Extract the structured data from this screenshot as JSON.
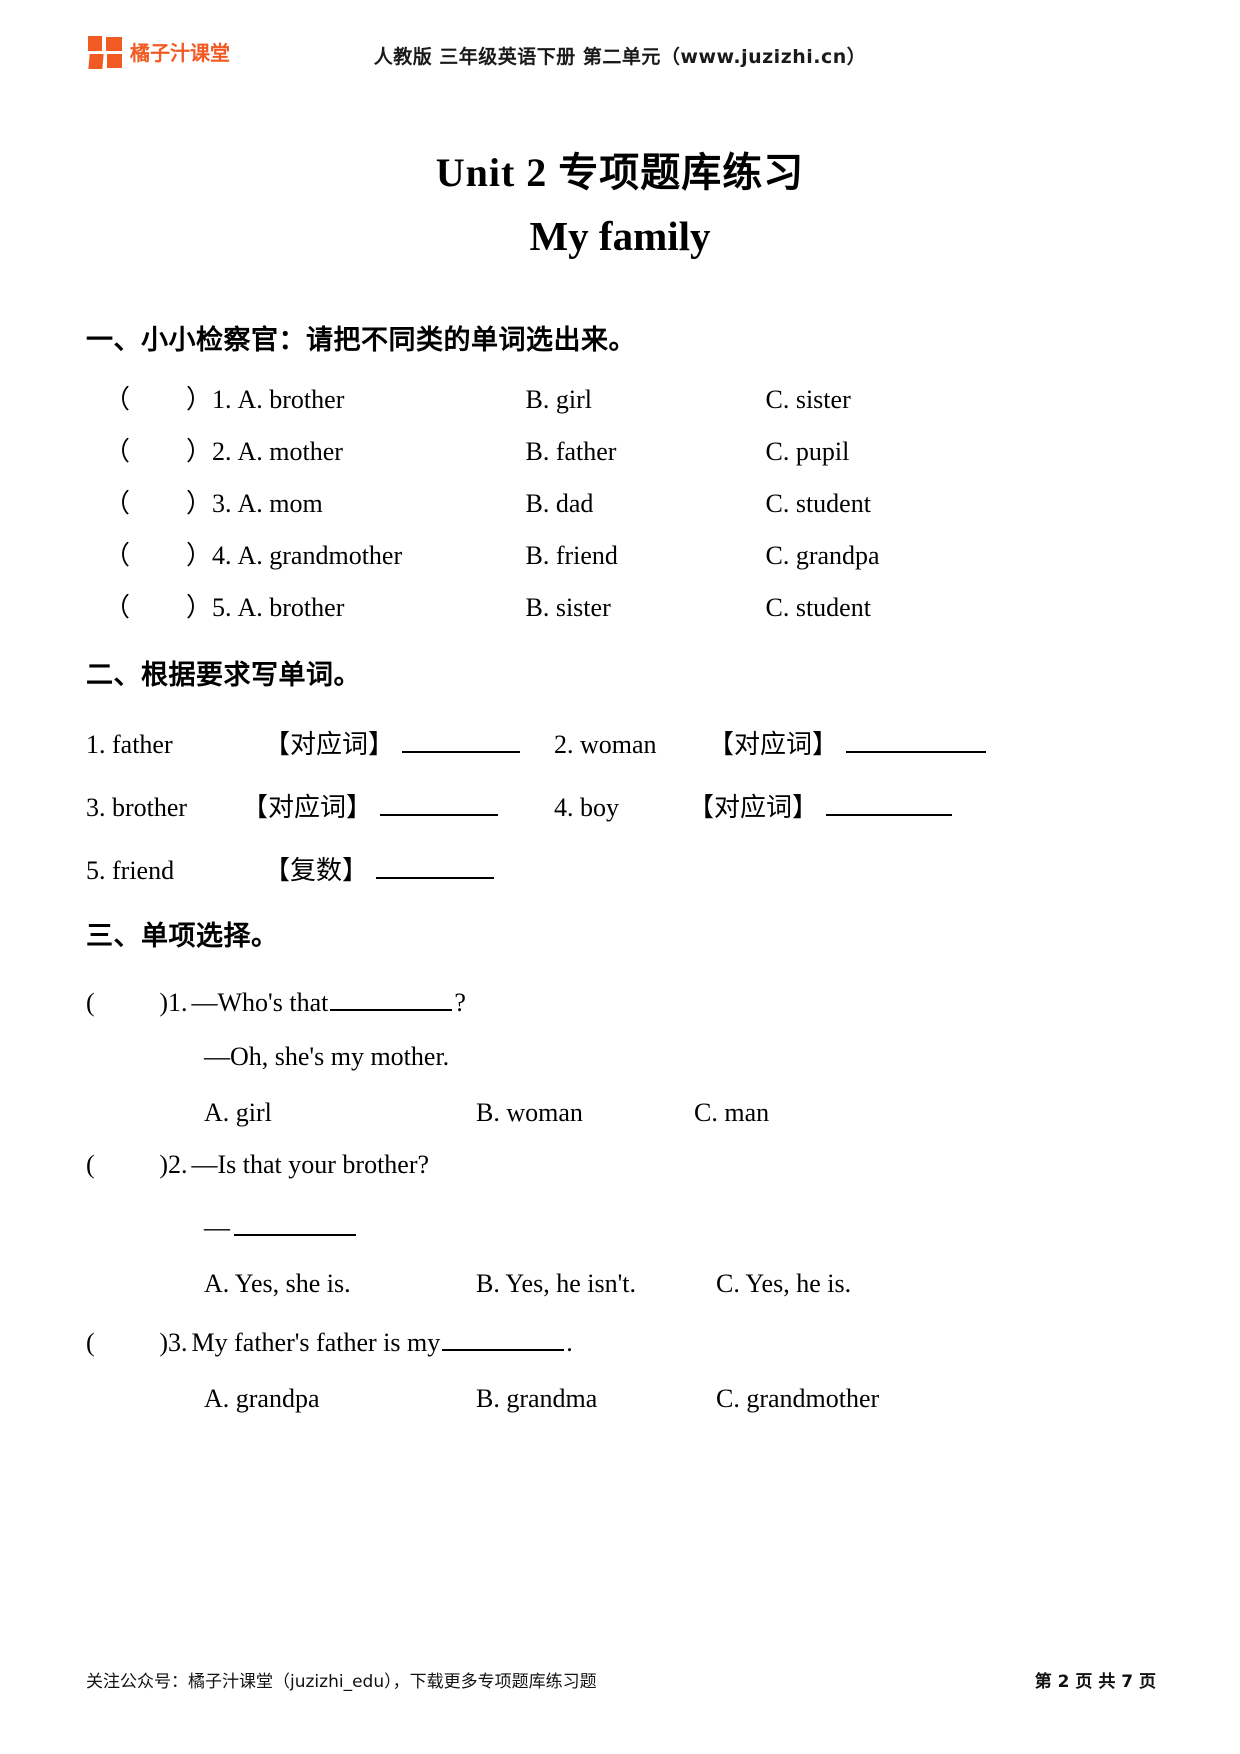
{
  "header": {
    "logo_text": "橘子汁课堂",
    "logo_icon": "four-square-grid-icon",
    "title": "人教版 三年级英语下册 第二单元（www.juzizhi.cn）",
    "brand_color": "#f15a22"
  },
  "title": {
    "main": "Unit 2  专项题库练习",
    "sub": "My family"
  },
  "sections": [
    {
      "heading": "一、小小检察官：请把不同类的单词选出来。",
      "questions": [
        {
          "paren_open": "（",
          "paren_close": "）",
          "num": "1.",
          "a": "A. brother",
          "b": "B. girl",
          "c": "C. sister"
        },
        {
          "paren_open": "（",
          "paren_close": "）",
          "num": "2.",
          "a": "A. mother",
          "b": "B. father",
          "c": "C. pupil"
        },
        {
          "paren_open": "（",
          "paren_close": "）",
          "num": "3.",
          "a": "A. mom",
          "b": "B. dad",
          "c": "C. student"
        },
        {
          "paren_open": "（",
          "paren_close": "）",
          "num": "4.",
          "a": "A. grandmother",
          "b": "B. friend",
          "c": "C. grandpa"
        },
        {
          "paren_open": "（",
          "paren_close": "）",
          "num": "5.",
          "a": "A. brother",
          "b": "B. sister",
          "c": "C. student"
        }
      ]
    },
    {
      "heading": "二、根据要求写单词。",
      "items": [
        {
          "num": "1.",
          "word": "father",
          "tag": "【对应词】"
        },
        {
          "num": "2.",
          "word": "woman",
          "tag": "【对应词】"
        },
        {
          "num": "3.",
          "word": "brother",
          "tag": "【对应词】"
        },
        {
          "num": "4.",
          "word": "boy",
          "tag": "【对应词】"
        },
        {
          "num": "5.",
          "word": "friend",
          "tag": "【复数】"
        }
      ]
    },
    {
      "heading": "三、单项选择。",
      "questions": [
        {
          "paren_open": "(",
          "paren_close": ")",
          "num": "1.",
          "stem_before": "—Who's that",
          "stem_after": "?",
          "second_line": "—Oh, she's my mother.",
          "a": "A. girl",
          "b": "B. woman",
          "c": "C. man"
        },
        {
          "paren_open": "(",
          "paren_close": ")",
          "num": "2.",
          "stem_before": "—Is that your brother?",
          "stem_after": "",
          "second_line": "—",
          "a": "A. Yes, she is.",
          "b": "B. Yes, he isn't.",
          "c": "C. Yes, he is."
        },
        {
          "paren_open": "(",
          "paren_close": ")",
          "num": "3.",
          "stem_before": "My father's father is my",
          "stem_after": ".",
          "second_line": "",
          "a": "A. grandpa",
          "b": "B. grandma",
          "c": "C. grandmother"
        }
      ]
    }
  ],
  "footer": {
    "left": "关注公众号：橘子汁课堂（juzizhi_edu），下载更多专项题库练习题",
    "right": "第 2 页 共 7 页"
  }
}
